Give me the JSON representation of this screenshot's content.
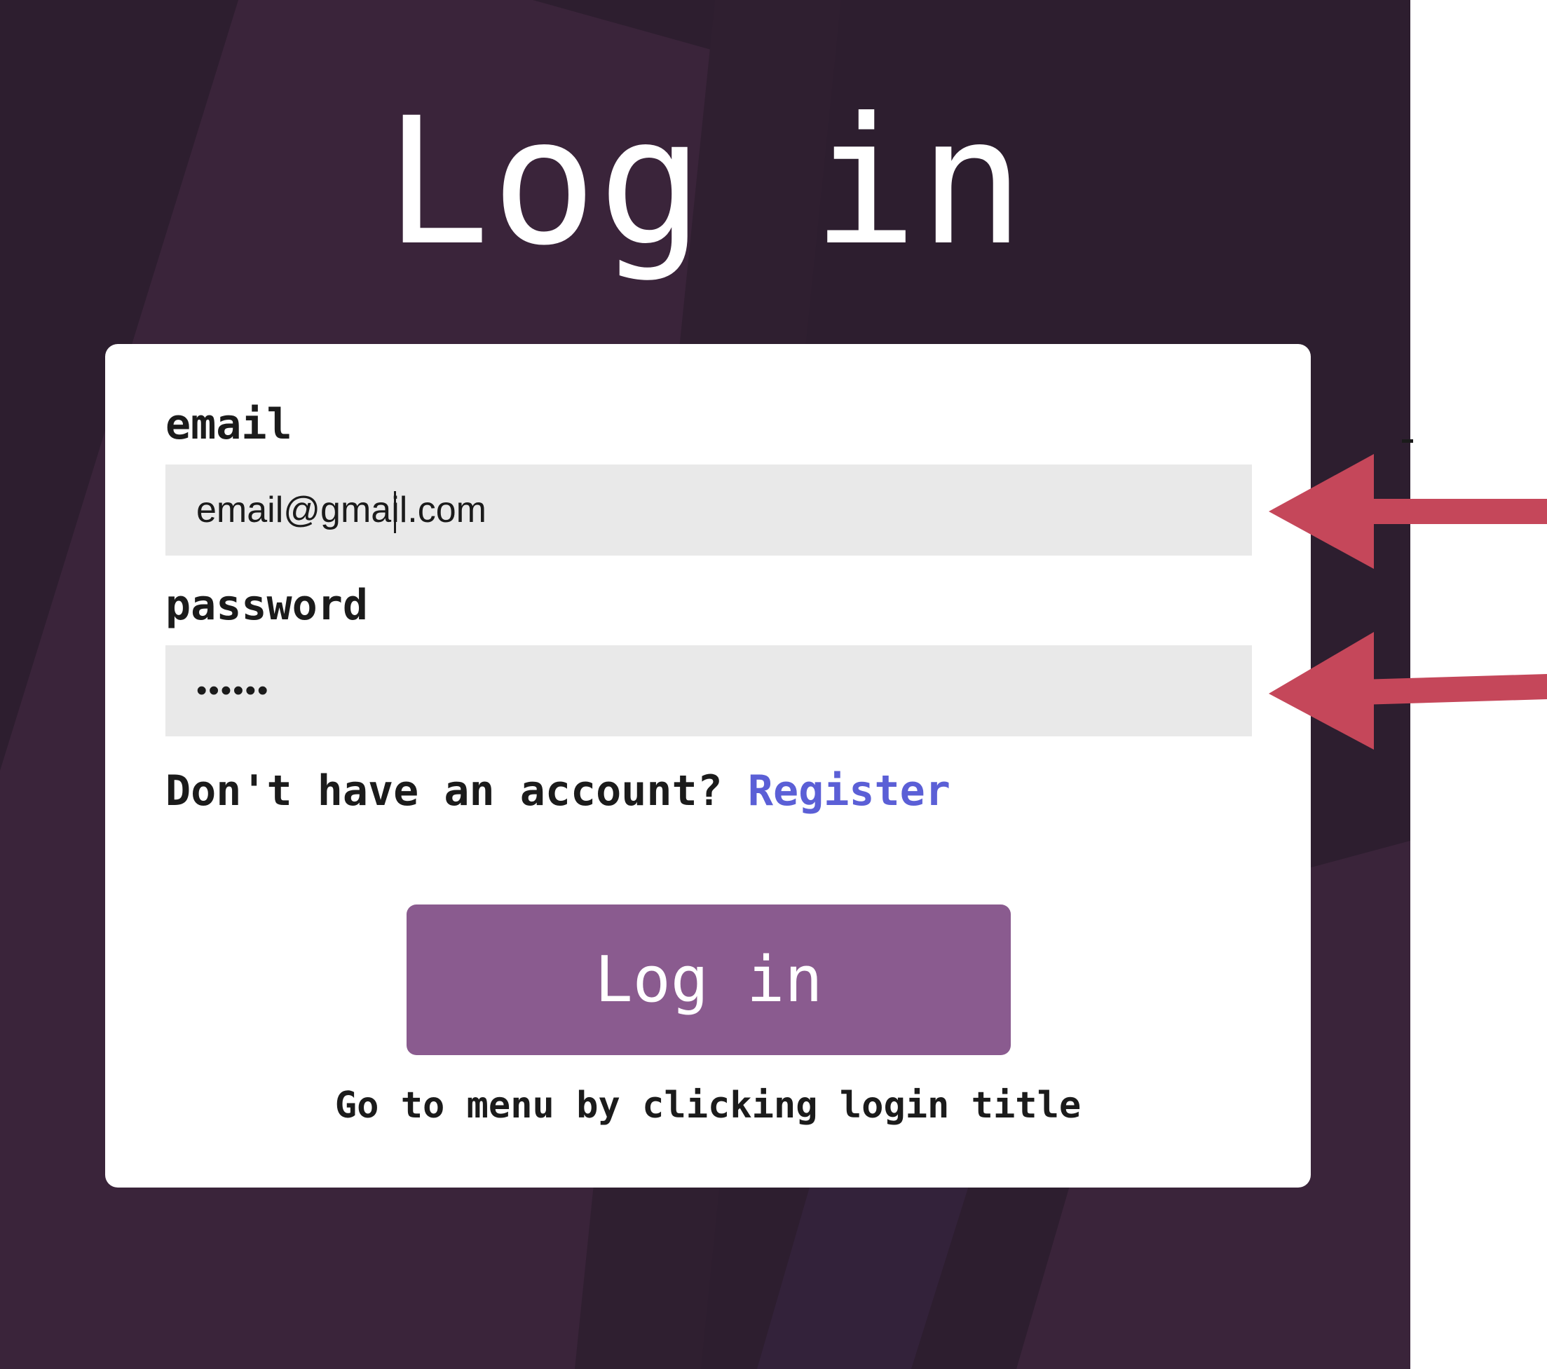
{
  "page": {
    "title": "Log in"
  },
  "form": {
    "email_label": "email",
    "email_value": "email@gmail.com",
    "password_label": "password",
    "password_value": "••••••",
    "register_prompt": "Don't have an account?",
    "register_link": "Register",
    "submit_label": "Log in",
    "hint": "Go to menu by clicking login title"
  },
  "annotations": {
    "arrow_count": 2,
    "arrow_color": "#c5475a"
  },
  "colors": {
    "background": "#2d1e2f",
    "background_accent": "#3a243a",
    "button": "#8a5b8f",
    "link": "#5b5fd6",
    "input_bg": "#e9e9e9"
  }
}
